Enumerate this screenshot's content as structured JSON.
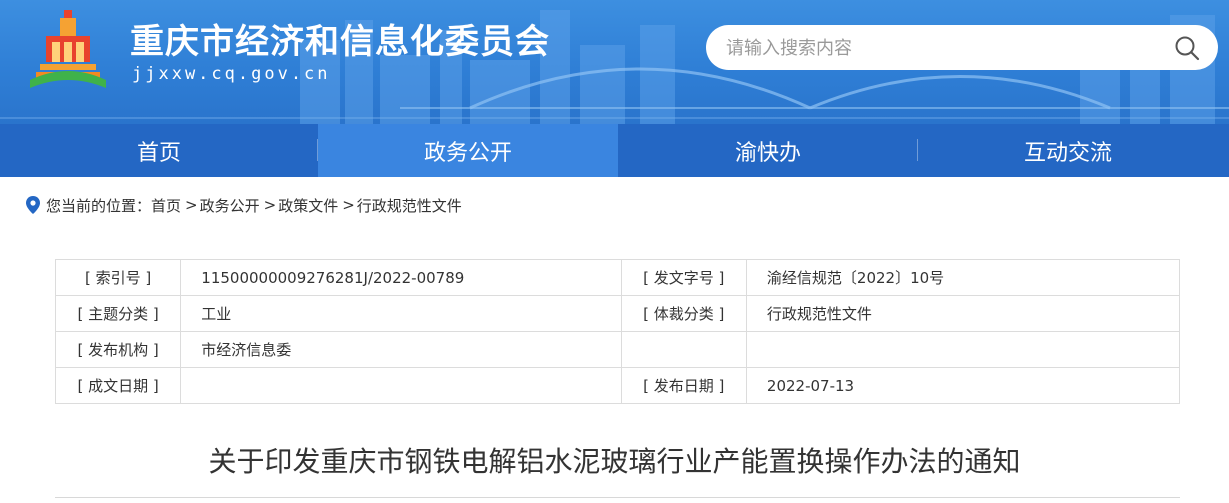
{
  "header": {
    "site_title": "重庆市经济和信息化委员会",
    "site_domain": "jjxxw.cq.gov.cn",
    "search_placeholder": "请输入搜索内容",
    "search_icon": "search-icon",
    "logo_icon": "emblem-logo",
    "colors": {
      "banner": "#2f7fd6",
      "nav": "#2467c4",
      "nav_active": "#3a85e0"
    }
  },
  "nav": {
    "items": [
      {
        "label": "首页",
        "active": false
      },
      {
        "label": "政务公开",
        "active": true
      },
      {
        "label": "渝快办",
        "active": false
      },
      {
        "label": "互动交流",
        "active": false
      }
    ]
  },
  "breadcrumb": {
    "prefix": "您当前的位置：",
    "items": [
      "首页",
      "政务公开",
      "政策文件",
      "行政规范性文件"
    ],
    "separator": ">"
  },
  "meta_table": {
    "rows": [
      [
        "[ 索引号 ]",
        "11500000009276281J/2022-00789",
        "[ 发文字号 ]",
        "渝经信规范〔2022〕10号"
      ],
      [
        "[ 主题分类 ]",
        "工业",
        "[ 体裁分类 ]",
        "行政规范性文件"
      ],
      [
        "[ 发布机构 ]",
        "市经济信息委",
        "",
        ""
      ],
      [
        "[ 成文日期 ]",
        "",
        "[ 发布日期 ]",
        "2022-07-13"
      ]
    ]
  },
  "document": {
    "title": "关于印发重庆市钢铁电解铝水泥玻璃行业产能置换操作办法的通知"
  }
}
